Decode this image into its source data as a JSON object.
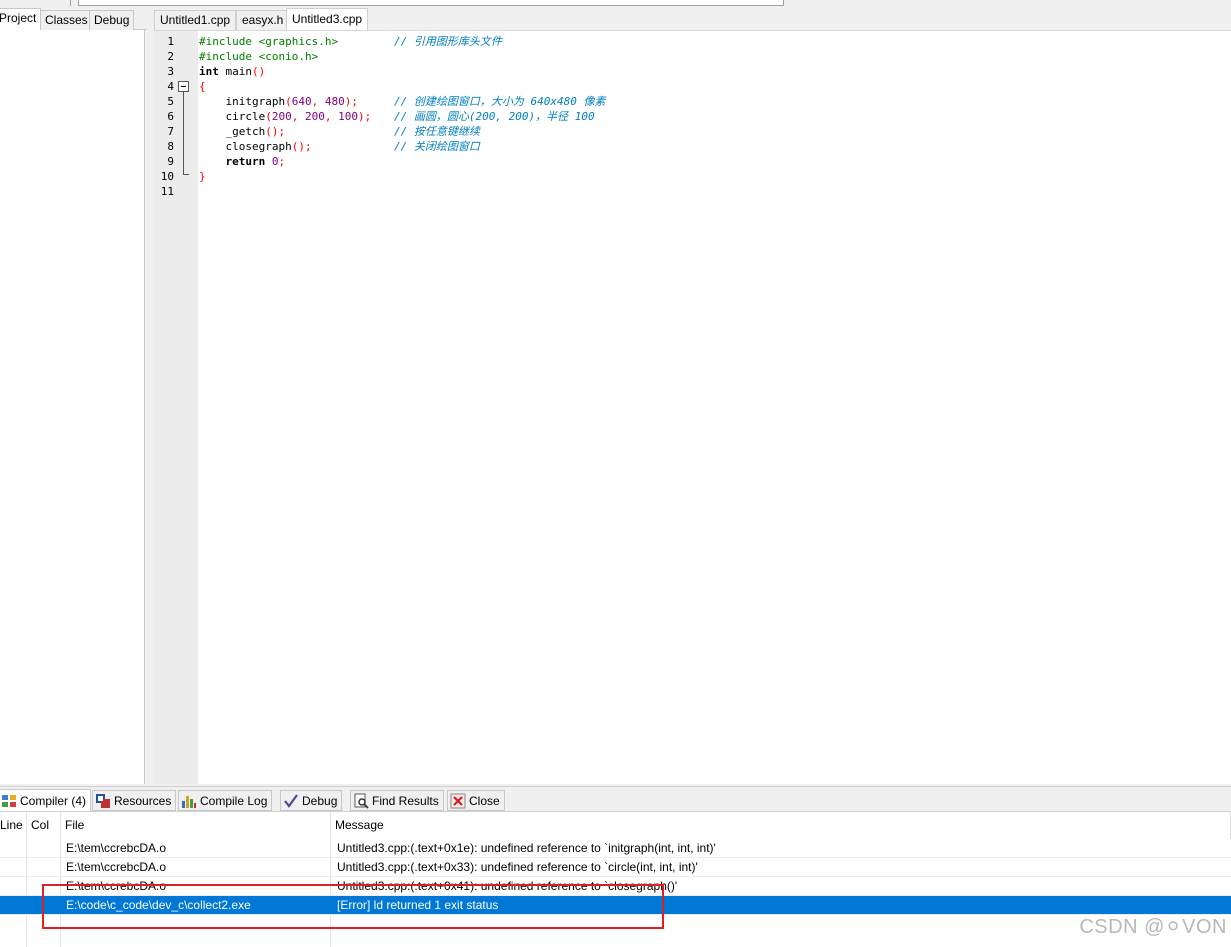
{
  "left_panel": {
    "tabs": [
      {
        "label": "Project",
        "active": true
      },
      {
        "label": "Classes",
        "active": false
      },
      {
        "label": "Debug",
        "active": false
      }
    ]
  },
  "editor": {
    "tabs": [
      {
        "label": "Untitled1.cpp",
        "active": false
      },
      {
        "label": "easyx.h",
        "active": false
      },
      {
        "label": "Untitled3.cpp",
        "active": true
      }
    ],
    "line_numbers": [
      "1",
      "2",
      "3",
      "4",
      "5",
      "6",
      "7",
      "8",
      "9",
      "10",
      "11"
    ],
    "code": {
      "l1_pp": "#include <graphics.h>",
      "l1_cm": "// 引用图形库头文件",
      "l2_pp": "#include <conio.h>",
      "l3_kw": "int",
      "l3_fn": " main",
      "l3_sym": "()",
      "l4_sym": "{",
      "l5_fn": "    initgraph",
      "l5_sym1": "(",
      "l5_num1": "640",
      "l5_sym2": ", ",
      "l5_num2": "480",
      "l5_sym3": ");",
      "l5_cm": "// 创建绘图窗口，大小为 640x480 像素",
      "l6_fn": "    circle",
      "l6_sym1": "(",
      "l6_num1": "200",
      "l6_sym2": ", ",
      "l6_num2": "200",
      "l6_sym3": ", ",
      "l6_num3": "100",
      "l6_sym4": ");",
      "l6_cm": "// 画圆，圆心(200, 200)，半径 100",
      "l7_fn": "    _getch",
      "l7_sym": "();",
      "l7_cm": "// 按任意键继续",
      "l8_fn": "    closegraph",
      "l8_sym": "();",
      "l8_cm": "// 关闭绘图窗口",
      "l9_kw": "    return",
      "l9_num": " 0",
      "l9_sym": ";",
      "l10_sym": "}"
    },
    "current_line_color": "#ccffff"
  },
  "bottom_panel": {
    "tabs": [
      {
        "label": "Compiler (4)",
        "icon": "compiler-grid-icon",
        "active": true
      },
      {
        "label": "Resources",
        "icon": "resources-icon",
        "active": false
      },
      {
        "label": "Compile Log",
        "icon": "compile-log-chart-icon",
        "active": false
      },
      {
        "label": "Debug",
        "icon": "debug-check-icon",
        "active": false
      },
      {
        "label": "Find Results",
        "icon": "find-results-icon",
        "active": false
      },
      {
        "label": "Close",
        "icon": "close-icon",
        "active": false
      }
    ],
    "columns": [
      "Line",
      "Col",
      "File",
      "Message"
    ],
    "rows": [
      {
        "line": "",
        "col": "",
        "file": "E:\\tem\\ccrebcDA.o",
        "message": "Untitled3.cpp:(.text+0x1e): undefined reference to `initgraph(int, int, int)'"
      },
      {
        "line": "",
        "col": "",
        "file": "E:\\tem\\ccrebcDA.o",
        "message": "Untitled3.cpp:(.text+0x33): undefined reference to `circle(int, int, int)'"
      },
      {
        "line": "",
        "col": "",
        "file": "E:\\tem\\ccrebcDA.o",
        "message": "Untitled3.cpp:(.text+0x41): undefined reference to `closegraph()'"
      },
      {
        "line": "",
        "col": "",
        "file": "E:\\code\\c_code\\dev_c\\collect2.exe",
        "message": "[Error] ld returned 1 exit status",
        "selected": true
      }
    ],
    "selection_color": "#0078d7",
    "highlight_box_color": "#e02020"
  },
  "watermark": "CSDN @⚪VON"
}
